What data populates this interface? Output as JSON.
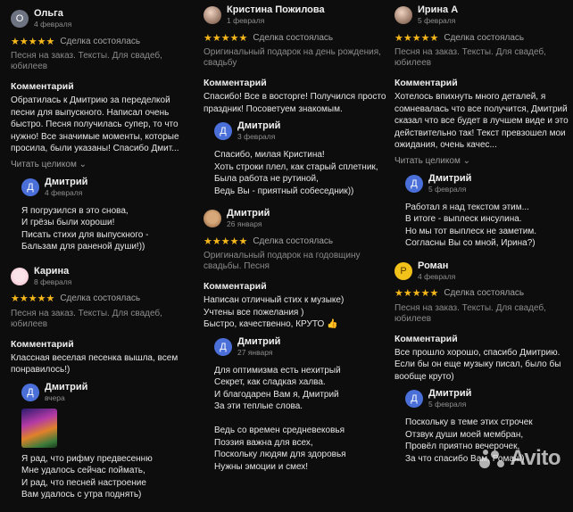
{
  "reviews_col1": [
    {
      "author": "Ольга",
      "avatar_letter": "О",
      "date": "4 февраля",
      "stars": "★★★★★",
      "status": "Сделка состоялась",
      "service": "Песня на заказ. Тексты. Для свадеб, юбилеев",
      "comment_label": "Комментарий",
      "comment": "Обратилась к Дмитрию за переделкой песни для выпускного. Написал очень быстро. Песня получилась супер, то что нужно! Все значимые моменты, которые просила, были указаны! Спасибо Дмит...",
      "read_more": "Читать целиком ⌄",
      "reply": {
        "author": "Дмитрий",
        "avatar_letter": "Д",
        "date": "4 февраля",
        "text": "Я погрузился в это снова,\nИ грёзы были хороши!\nПисать стихи для выпускного -\nБальзам для раненой души!))"
      }
    },
    {
      "author": "Карина",
      "date": "8 февраля",
      "stars": "★★★★★",
      "status": "Сделка состоялась",
      "service": "Песня на заказ. Тексты. Для свадеб, юбилеев",
      "comment_label": "Комментарий",
      "comment": "Классная веселая песенка вышла, всем понравилось!)",
      "reply": {
        "author": "Дмитрий",
        "avatar_letter": "Д",
        "date": "вчера",
        "text": "Я рад, что рифму предвесенню\nМне удалось сейчас поймать,\nИ рад, что песней настроение\nВам удалось с утра поднять)"
      }
    }
  ],
  "reviews_col2": [
    {
      "author": "Кристина Пожилова",
      "date": "1 февраля",
      "stars": "★★★★★",
      "status": "Сделка состоялась",
      "service": "Оригинальный подарок на день рождения, свадьбу",
      "comment_label": "Комментарий",
      "comment": "Спасибо! Все в восторге! Получился просто праздник! Посоветуем знакомым.",
      "reply": {
        "author": "Дмитрий",
        "avatar_letter": "Д",
        "date": "3 февраля",
        "text": "Спасибо, милая Кристина!\nХоть строки плел, как старый сплетник,\nБыла работа не рутиной,\nВедь Вы - приятный собеседник))"
      }
    },
    {
      "author": "Дмитрий",
      "date": "26 января",
      "stars": "★★★★★",
      "status": "Сделка состоялась",
      "service": "Оригинальный подарок на годовщину свадьбы. Песня",
      "comment_label": "Комментарий",
      "comment": "Написан отличный стих к музыке)\nУчтены все пожелания )\nБыстро, качественно, КРУТО",
      "comment_emoji": "👍",
      "reply": {
        "author": "Дмитрий",
        "avatar_letter": "Д",
        "date": "27 января",
        "text": "Для оптимизма есть нехитрый\nСекрет, как сладкая халва.\nИ благодарен Вам я, Дмитрий\nЗа эти теплые слова.\n\nВедь со времен средневековья\nПоэзия важна для всех,\nПоскольку людям для здоровья\nНужны эмоции и смех!"
      }
    }
  ],
  "reviews_col3": [
    {
      "author": "Ирина А",
      "date": "5 февраля",
      "stars": "★★★★★",
      "status": "Сделка состоялась",
      "service": "Песня на заказ. Тексты. Для свадеб, юбилеев",
      "comment_label": "Комментарий",
      "comment": "Хотелось впихнуть много деталей, я сомневалась что все получится, Дмитрий сказал что все будет в лучшем виде и это действительно так! Текст превзошел мои ожидания, очень качес...",
      "read_more": "Читать целиком ⌄",
      "reply": {
        "author": "Дмитрий",
        "avatar_letter": "Д",
        "date": "5 февраля",
        "text": "Работал я над текстом этим...\nВ итоге -  выплеск инсулина.\nНо мы тот выплеск не заметим.\nСогласны Вы со мной, Ирина?)"
      }
    },
    {
      "author": "Роман",
      "avatar_letter": "Р",
      "date": "4 февраля",
      "stars": "★★★★★",
      "status": "Сделка состоялась",
      "service": "Песня на заказ. Тексты. Для свадеб, юбилеев",
      "comment_label": "Комментарий",
      "comment": "Все прошло хорошо, спасибо Дмитрию. Если бы он еще музыку писал, было бы вообще круто)",
      "reply": {
        "author": "Дмитрий",
        "avatar_letter": "Д",
        "date": "5 февраля",
        "text": "Поскольку в теме этих строчек\nОтзвук души моей мембран,\nПровёл приятно вечерочек,\nЗа что спасибо Вам, Роман!)"
      }
    }
  ],
  "watermark": "Avito",
  "colors": {
    "background": "#0d0d0d",
    "stars": "#f6b81a",
    "reply_avatar": "#4a6fd8",
    "roman_avatar": "#f2c21b"
  }
}
